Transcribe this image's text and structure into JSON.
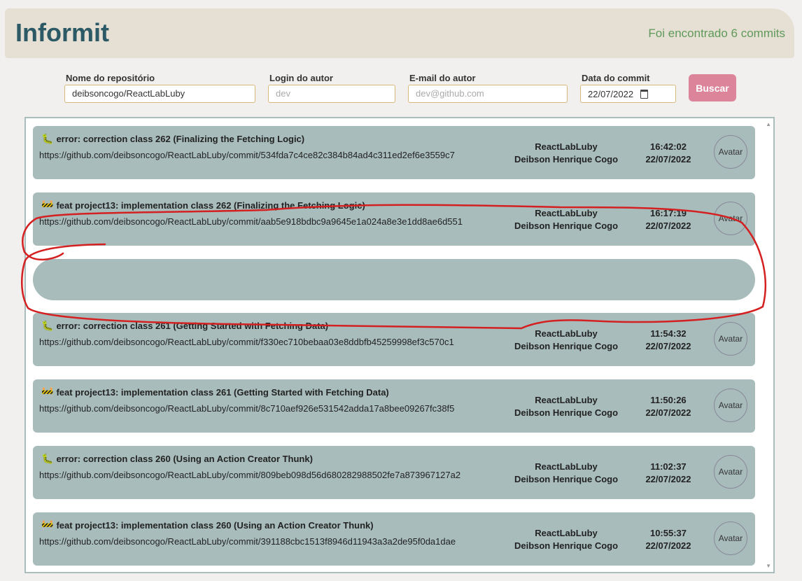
{
  "app": {
    "title": "Informit",
    "result_count": "Foi encontrado 6 commits"
  },
  "filters": {
    "repo_label": "Nome do repositório",
    "repo_value": "deibsoncogo/ReactLabLuby",
    "login_label": "Login do autor",
    "login_placeholder": "dev",
    "email_label": "E-mail do autor",
    "email_placeholder": "dev@github.com",
    "date_label": "Data do commit",
    "date_value": "22/07/2022",
    "search_button": "Buscar"
  },
  "commits": [
    {
      "emoji": "🐛",
      "message": "error: correction class 262 (Finalizing the Fetching Logic)",
      "url": "https://github.com/deibsoncogo/ReactLabLuby/commit/534fda7c4ce82c384b84ad4c311ed2ef6e3559c7",
      "repo": "ReactLabLuby",
      "author": "Deibson Henrique Cogo",
      "time": "16:42:02",
      "date": "22/07/2022",
      "avatar_alt": "Avatar"
    },
    {
      "emoji": "🚧",
      "message": "feat project13: implementation class 262 (Finalizing the Fetching Logic)",
      "url": "https://github.com/deibsoncogo/ReactLabLuby/commit/aab5e918bdbc9a9645e1a024a8e3e1dd8ae6d551",
      "repo": "ReactLabLuby",
      "author": "Deibson Henrique Cogo",
      "time": "16:17:19",
      "date": "22/07/2022",
      "avatar_alt": "Avatar"
    },
    {
      "emoji": "🐛",
      "message": "error: correction class 261 (Getting Started with Fetching Data)",
      "url": "https://github.com/deibsoncogo/ReactLabLuby/commit/f330ec710bebaa03e8ddbfb45259998ef3c570c1",
      "repo": "ReactLabLuby",
      "author": "Deibson Henrique Cogo",
      "time": "11:54:32",
      "date": "22/07/2022",
      "avatar_alt": "Avatar"
    },
    {
      "emoji": "🚧",
      "message": "feat project13: implementation class 261 (Getting Started with Fetching Data)",
      "url": "https://github.com/deibsoncogo/ReactLabLuby/commit/8c710aef926e531542adda17a8bee09267fc38f5",
      "repo": "ReactLabLuby",
      "author": "Deibson Henrique Cogo",
      "time": "11:50:26",
      "date": "22/07/2022",
      "avatar_alt": "Avatar"
    },
    {
      "emoji": "🐛",
      "message": "error: correction class 260 (Using an Action Creator Thunk)",
      "url": "https://github.com/deibsoncogo/ReactLabLuby/commit/809beb098d56d680282988502fe7a873967127a2",
      "repo": "ReactLabLuby",
      "author": "Deibson Henrique Cogo",
      "time": "11:02:37",
      "date": "22/07/2022",
      "avatar_alt": "Avatar"
    },
    {
      "emoji": "🚧",
      "message": "feat project13: implementation class 260 (Using an Action Creator Thunk)",
      "url": "https://github.com/deibsoncogo/ReactLabLuby/commit/391188cbc1513f8946d11943a3a2de95f0da1dae",
      "repo": "ReactLabLuby",
      "author": "Deibson Henrique Cogo",
      "time": "10:55:37",
      "date": "22/07/2022",
      "avatar_alt": "Avatar"
    }
  ],
  "colors": {
    "header_bg": "#e6dfd3",
    "brand": "#2b5965",
    "count": "#5f9a5a",
    "card_bg": "#a8bcbc",
    "button_bg": "#dc859a",
    "annotation": "#d42020"
  },
  "icons": {
    "calendar": "calendar-icon",
    "bug": "bug-icon",
    "construction": "construction-icon"
  }
}
